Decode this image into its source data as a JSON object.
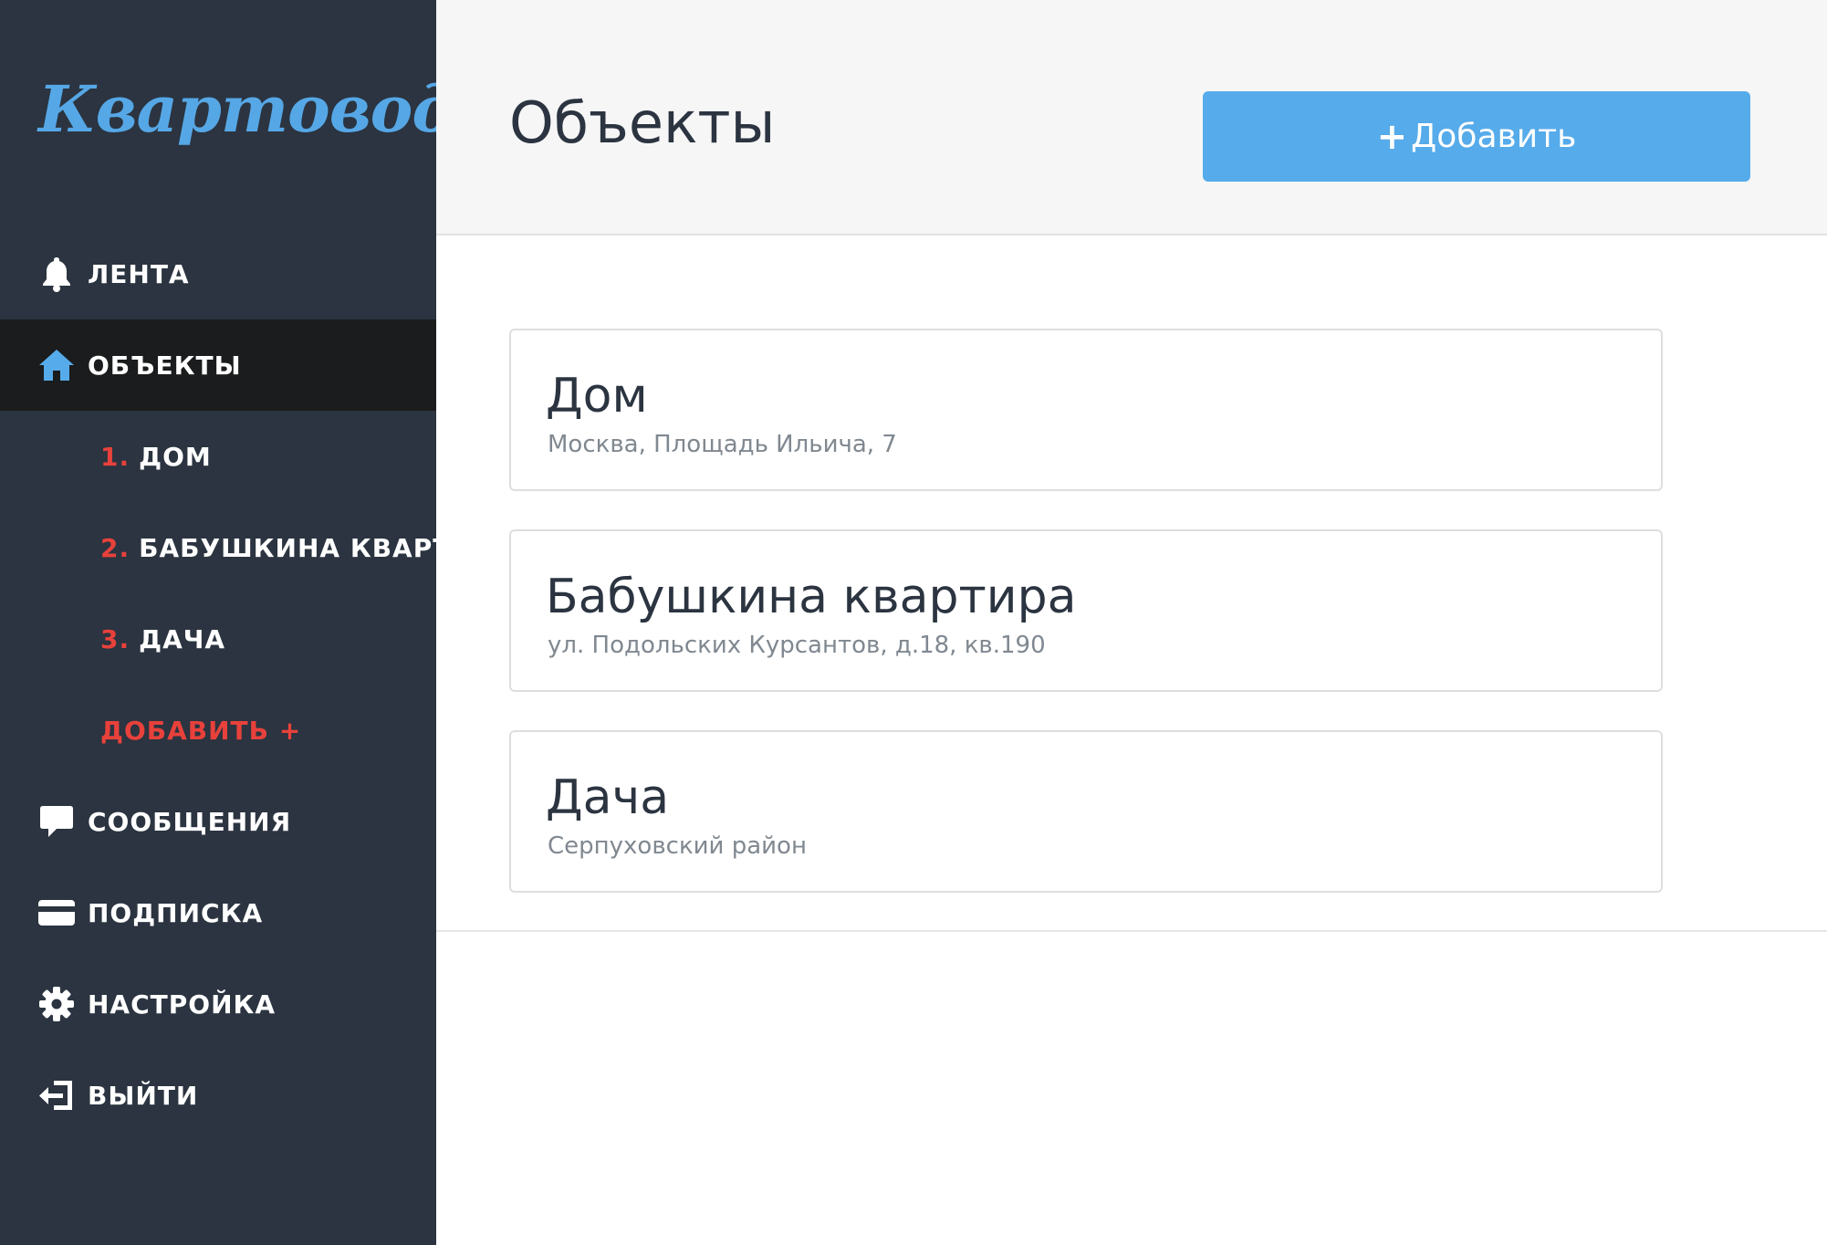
{
  "app": {
    "logo": "Квартовод"
  },
  "sidebar": {
    "items": [
      {
        "label": "ЛЕНТА",
        "icon": "bell-icon"
      },
      {
        "label": "ОБЪЕКТЫ",
        "icon": "home-icon",
        "active": true
      },
      {
        "num": "1.",
        "label": "ДОМ"
      },
      {
        "num": "2.",
        "label": "БАБУШКИНА КВАРТ..."
      },
      {
        "num": "3.",
        "label": "ДАЧА"
      },
      {
        "label": "ДОБАВИТЬ +"
      },
      {
        "label": "СООБЩЕНИЯ",
        "icon": "chat-bubble-icon"
      },
      {
        "label": "ПОДПИСКА",
        "icon": "credit-card-icon"
      },
      {
        "label": "НАСТРОЙКА",
        "icon": "gear-icon"
      },
      {
        "label": "ВЫЙТИ",
        "icon": "logout-icon"
      }
    ]
  },
  "header": {
    "title": "Объекты",
    "add_button": {
      "plus": "+",
      "label": "Добавить"
    }
  },
  "objects": [
    {
      "title": "Дом",
      "address": "Москва, Площадь Ильича, 7"
    },
    {
      "title": "Бабушкина квартира",
      "address": "ул. Подольских Курсантов, д.18, кв.190"
    },
    {
      "title": "Дача",
      "address": "Серпуховский район"
    }
  ],
  "colors": {
    "sidebar_bg": "#2b3440",
    "active_bg": "#1b1c1d",
    "accent_blue": "#56abea",
    "accent_red": "#e8413b"
  }
}
